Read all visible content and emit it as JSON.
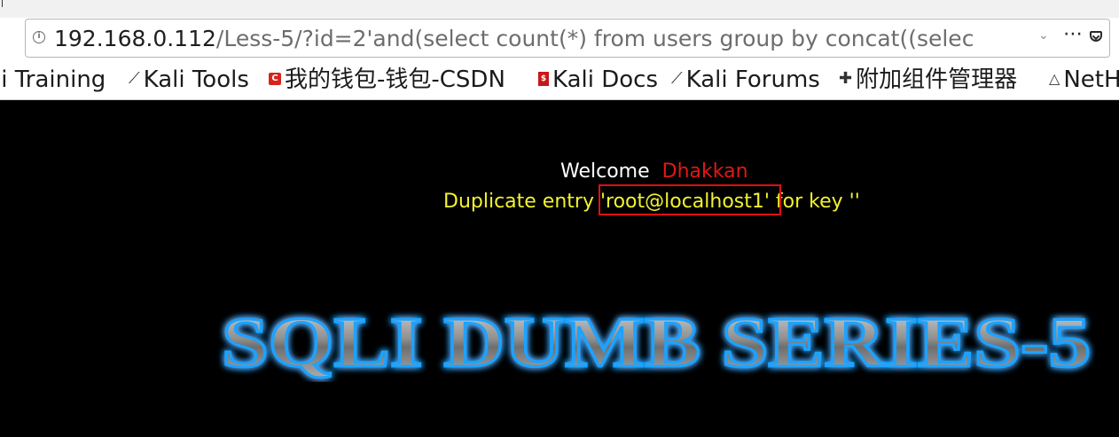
{
  "browser": {
    "url_host": "192.168.0.112",
    "url_path": "/Less-5/?id=2'and(select count(*) from users group by concat((selec",
    "bookmarks": [
      {
        "label": "li Training"
      },
      {
        "label": "Kali Tools"
      },
      {
        "label": "我的钱包-钱包-CSDN"
      },
      {
        "label": "Kali Docs"
      },
      {
        "label": "Kali Forums"
      },
      {
        "label": "附加组件管理器"
      },
      {
        "label": "NetH"
      }
    ],
    "icons": {
      "info": "info-icon",
      "dropdown": "chevron-down-icon",
      "more": "more-icon",
      "pocket": "pocket-icon",
      "star": "star-icon",
      "kali": "kali-dragon-icon",
      "csdn": "csdn-icon",
      "docs": "docs-icon",
      "addons": "puzzle-icon",
      "nethunter": "nethunter-icon"
    }
  },
  "page": {
    "welcome_label": "Welcome",
    "username": "Dhakkan",
    "error_prefix": "Duplicate entry ",
    "error_value": "'root@localhost1'",
    "error_suffix": " for key ''",
    "logo_text": "SQLI DUMB SERIES-5"
  },
  "colors": {
    "page_bg": "#000000",
    "welcome": "#ffffff",
    "username": "#e01818",
    "error_text": "#f2f230",
    "highlight_box": "#e01010",
    "logo_glow": "#1aa3ff"
  }
}
